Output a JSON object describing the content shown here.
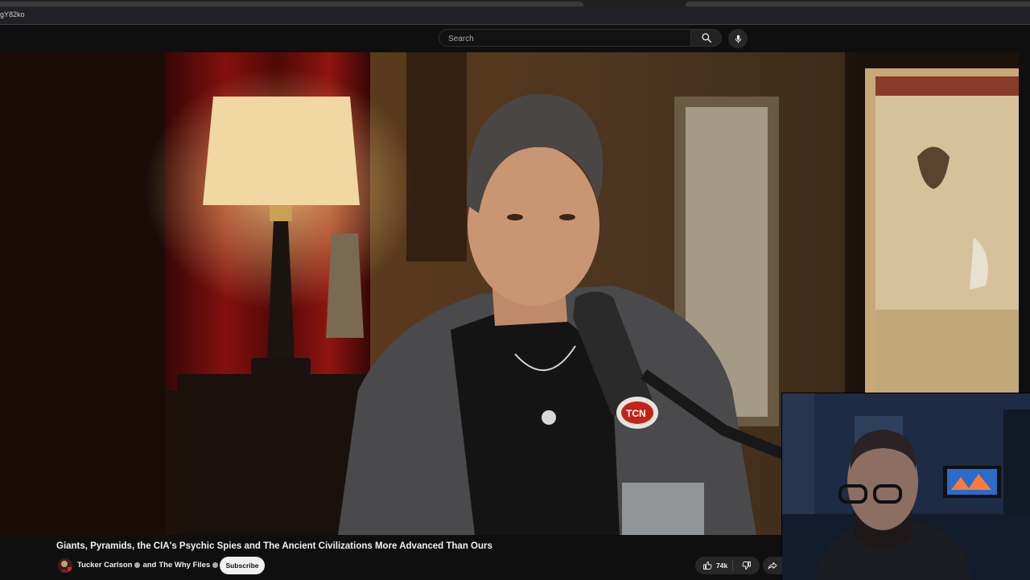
{
  "browser": {
    "url_text": "gY82ko"
  },
  "header": {
    "search_placeholder": "Search",
    "icons": [
      "search-icon",
      "microphone-icon"
    ]
  },
  "video": {
    "title": "Giants, Pyramids, the CIA's Psychic Spies and The Ancient Civilizations More Advanced Than Ours",
    "mic_logo_text": "TCN"
  },
  "channel": {
    "name": "Tucker Carlson",
    "joiner": "and",
    "collaborator": "The Why Files",
    "subscribe_label": "Subscribe"
  },
  "actions": {
    "like_count": "74k",
    "icons": [
      "thumbs-up-icon",
      "thumbs-down-icon",
      "share-icon"
    ]
  },
  "colors": {
    "background": "#0f0f0f",
    "subscribe_bg": "#f1f1f1",
    "chip_bg": "#272727"
  }
}
